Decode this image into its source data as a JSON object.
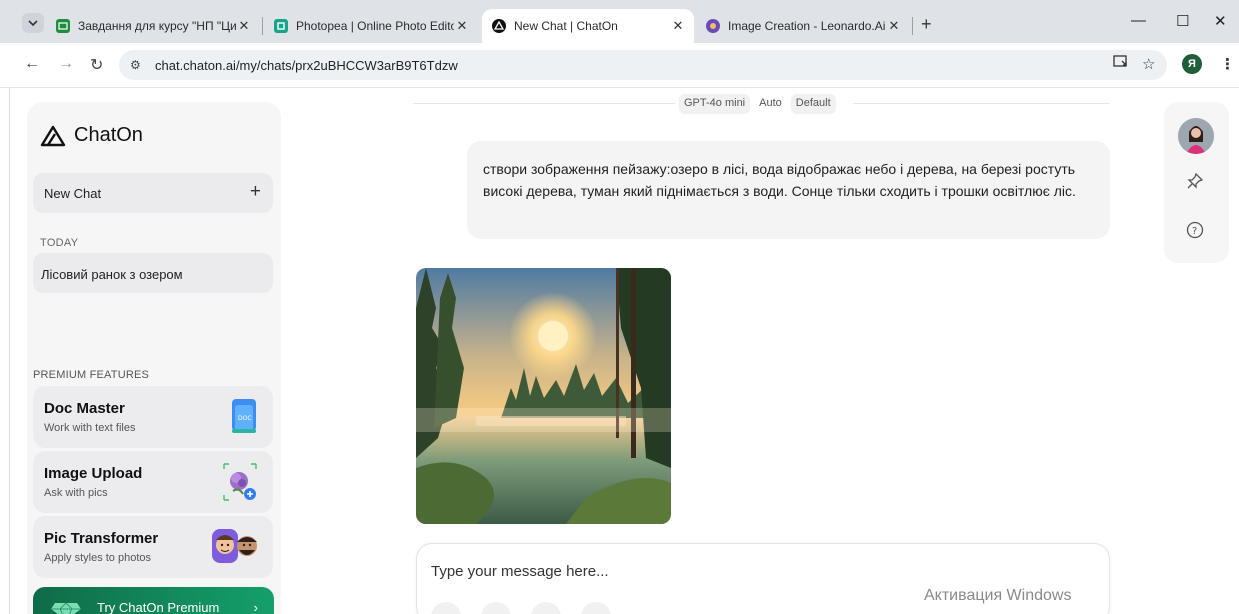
{
  "browser": {
    "tabs": [
      {
        "title": "Завдання для курсу \"НП \"Циф",
        "favicon": "classroom-icon"
      },
      {
        "title": "Photopea | Online Photo Editor",
        "favicon": "photopea-icon"
      },
      {
        "title": "New Chat | ChatOn",
        "favicon": "chaton-icon",
        "active": true
      },
      {
        "title": "Image Creation - Leonardo.Ai",
        "favicon": "leonardo-icon"
      }
    ],
    "url": "chat.chaton.ai/my/chats/prx2uBHCCW3arB9T6Tdzw",
    "profile_initial": "Я"
  },
  "sidebar": {
    "logo_text": "ChatOn",
    "new_chat_label": "New Chat",
    "today_header": "TODAY",
    "history": [
      "Лісовий ранок з озером"
    ],
    "premium_header": "PREMIUM FEATURES",
    "premium_features": [
      {
        "title": "Doc Master",
        "subtitle": "Work with text files",
        "icon": "doc-file-icon"
      },
      {
        "title": "Image Upload",
        "subtitle": "Ask with pics",
        "icon": "flower-upload-icon"
      },
      {
        "title": "Pic Transformer",
        "subtitle": "Apply styles to photos",
        "icon": "face-avatars-icon"
      }
    ],
    "try_premium_label": "Try ChatOn Premium"
  },
  "chat": {
    "model_options": [
      "GPT-4o mini",
      "Auto",
      "Default"
    ],
    "user_message": "створи зображення пейзажу:озеро в лісі, вода відображає небо і дерева, на березі ростуть високі дерева, туман який піднімається з води. Сонце тільки сходить і трошки освітлює ліс.",
    "generated_image": "forest-lake-sunrise-image",
    "input_placeholder": "Type your message here..."
  },
  "overlay": {
    "activation_text": "Активация Windows"
  },
  "colors": {
    "premium_green": "#14a06a",
    "sidebar_bg": "#f6f6f7",
    "bubble_bg": "#f4f4f5"
  }
}
